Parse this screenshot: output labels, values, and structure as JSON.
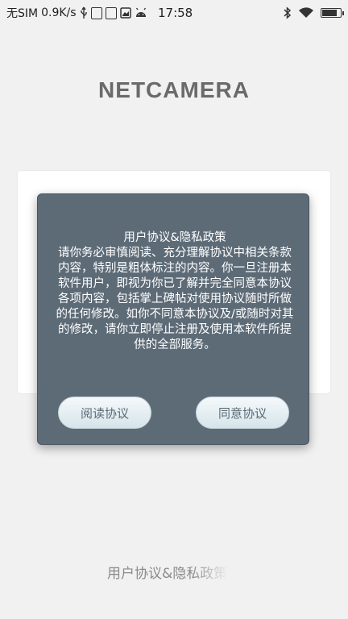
{
  "status_bar": {
    "carrier": "无SIM",
    "speed": "0.9K/s",
    "time": "17:58",
    "battery_level": 0.85
  },
  "app": {
    "title": "NETCAMERA",
    "bottom_link": "用户协议&隐私政策"
  },
  "dialog": {
    "title": "用户协议&隐私政策",
    "body": "请你务必审慎阅读、充分理解协议中相关条款内容，特别是粗体标注的内容。你一旦注册本软件用户，即视为你已了解并完全同意本协议各项内容，包括掌上碑帖对使用协议随时所做的任何修改。如你不同意本协议及/或随时对其的修改，请你立即停止注册及使用本软件所提供的全部服务。",
    "read_button": "阅读协议",
    "agree_button": "同意协议"
  },
  "colors": {
    "dialog_bg": "#5d6b77",
    "background": "#f1f1f1",
    "title_color": "#6a6a6a"
  }
}
